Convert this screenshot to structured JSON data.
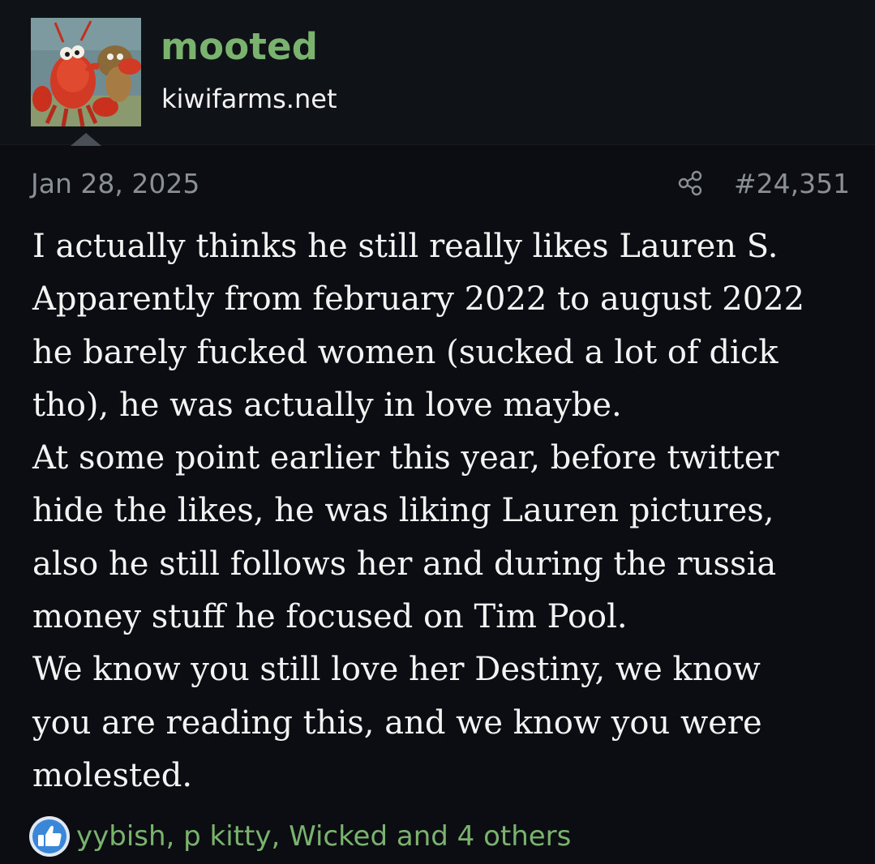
{
  "author": {
    "username": "mooted",
    "site": "kiwifarms.net",
    "avatar_icon": "lobster-avatar"
  },
  "post": {
    "date": "Jan 28, 2025",
    "share_icon": "share-icon",
    "number": "#24,351",
    "body_lines": [
      "I actually thinks he still really likes Lauren S.",
      "Apparently from february 2022 to august 2022",
      "he barely fucked women (sucked a lot of dick",
      "tho), he was actually in love maybe.",
      "At some point earlier this year, before twitter",
      "hide the likes, he was liking Lauren pictures,",
      "also he still follows her and during the russia",
      "money stuff he focused on Tim Pool.",
      "We know you still love her Destiny, we know",
      "you are reading this, and we know you were",
      "molested."
    ]
  },
  "reactions": {
    "icon": "like-icon",
    "text": "yybish, p kitty, Wicked and 4 others"
  },
  "colors": {
    "background": "#0b0d12",
    "header_background": "#0f1217",
    "username": "#79b36d",
    "meta": "#8a8f96",
    "body_text": "#f3f3f3",
    "reactions_text": "#79b36d",
    "like_blue": "#3a86d9"
  }
}
